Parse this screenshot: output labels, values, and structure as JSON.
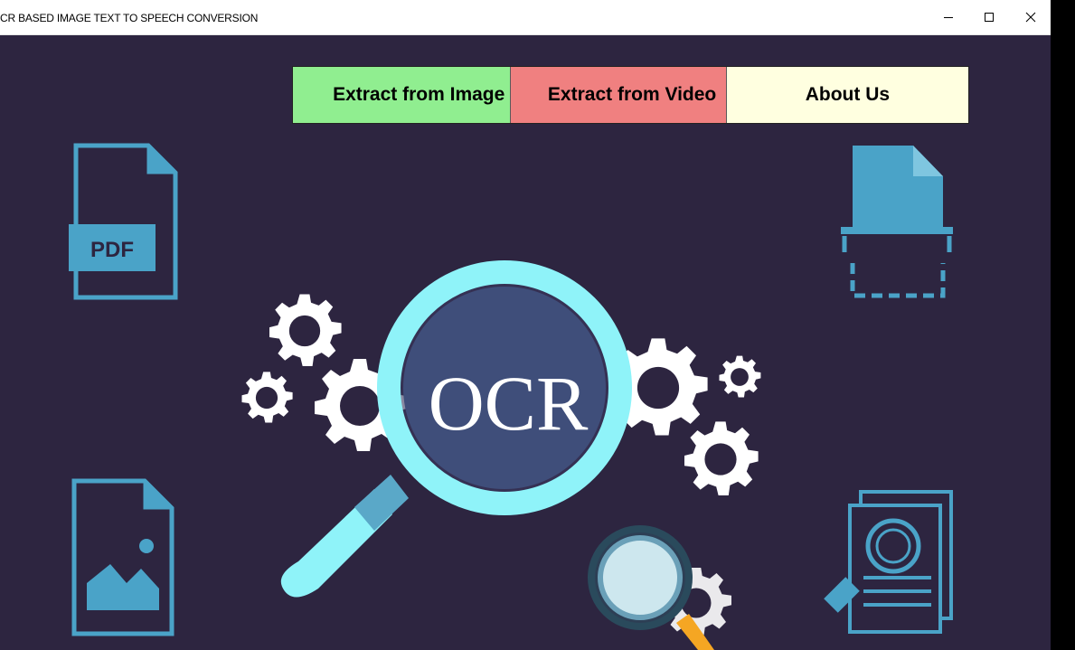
{
  "window": {
    "title": "CR BASED IMAGE TEXT TO SPEECH CONVERSION",
    "controls": {
      "minimize_icon": "minimize-icon",
      "maximize_icon": "maximize-icon",
      "close_icon": "close-icon"
    }
  },
  "nav": {
    "extract_image_label": "Extract from Image",
    "extract_video_label": "Extract from Video",
    "about_label": "About Us",
    "colors": {
      "image": "#90ee90",
      "video": "#f08080",
      "about": "#ffffe0"
    }
  },
  "banner": {
    "ocr_text": "OCR",
    "pdf_label": "PDF",
    "background": "#2d2540",
    "accent": "#4aa3c8",
    "lens_color": "#8ff3f9"
  }
}
